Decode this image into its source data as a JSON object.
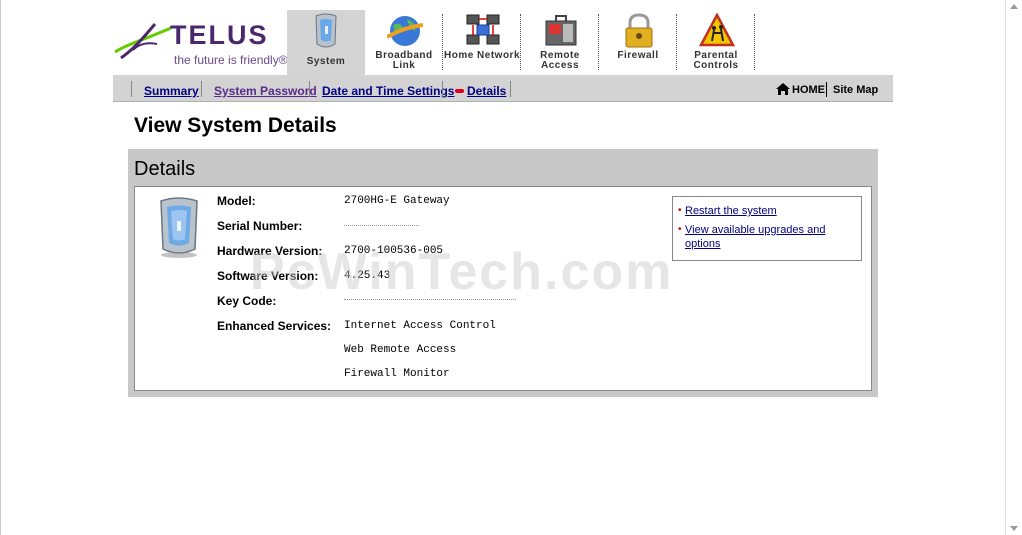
{
  "logo": {
    "brand": "TELUS",
    "tagline": "the future is friendly®"
  },
  "tabs": [
    {
      "label": "System",
      "icon": "system-device-icon"
    },
    {
      "label": "Broadband Link",
      "icon": "globe-icon"
    },
    {
      "label": "Home Network",
      "icon": "network-icon"
    },
    {
      "label": "Remote Access",
      "icon": "briefcase-icon"
    },
    {
      "label": "Firewall",
      "icon": "padlock-icon"
    },
    {
      "label": "Parental Controls",
      "icon": "warning-sign-icon"
    }
  ],
  "subnav": {
    "items": [
      "Summary",
      "System Password",
      "Date and Time Settings",
      "Details"
    ],
    "home": "HOME",
    "sitemap": "Site Map"
  },
  "page": {
    "title": "View System Details"
  },
  "details": {
    "title": "Details",
    "model_label": "Model:",
    "model_value": "2700HG-E Gateway",
    "serial_label": "Serial Number:",
    "hardware_label": "Hardware Version:",
    "hardware_value": "2700-100536-005",
    "software_label": "Software Version:",
    "software_value": "4.25.43",
    "key_label": "Key Code:",
    "enhanced_label": "Enhanced Services:",
    "services": [
      "Internet Access Control",
      "Web Remote Access",
      "Firewall Monitor"
    ]
  },
  "actions": {
    "restart": "Restart the system",
    "upgrades_line1": "View available upgrades and",
    "upgrades_line2": "options"
  },
  "watermark": "PcWinTech.com",
  "colors": {
    "brand_purple": "#4b286d",
    "brand_green": "#66cc00",
    "link": "#000080",
    "active_marker": "#e0001b"
  }
}
